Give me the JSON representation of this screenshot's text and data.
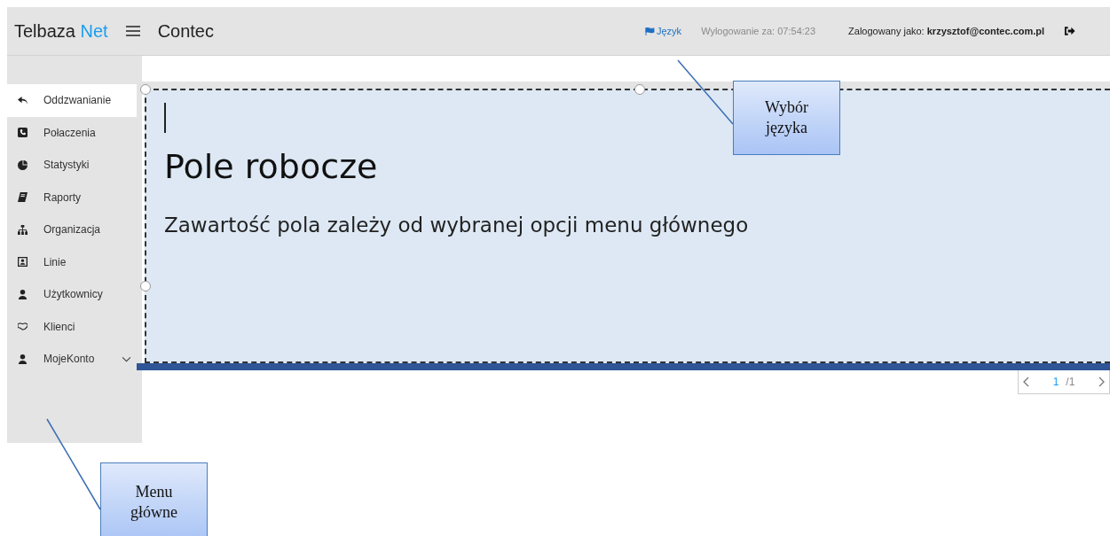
{
  "header": {
    "logo": {
      "text": "Telbaza",
      "accent": "Net"
    },
    "title": "Contec",
    "language_link": "Język",
    "logout_timer": "Wylogowanie za: 07:54:23",
    "logged_in": "Zalogowany jako: **krzysztof@contec.com.pl**"
  },
  "sidebar": {
    "items": [
      {
        "label": "Oddzwanianie",
        "selected": true,
        "expandable": false
      },
      {
        "label": "Połaczenia",
        "selected": false,
        "expandable": false
      },
      {
        "label": "Statystyki",
        "selected": false,
        "expandable": false
      },
      {
        "label": "Raporty",
        "selected": false,
        "expandable": false
      },
      {
        "label": "Organizacja",
        "selected": false,
        "expandable": false
      },
      {
        "label": "Linie",
        "selected": false,
        "expandable": false
      },
      {
        "label": "Użytkownicy",
        "selected": false,
        "expandable": false
      },
      {
        "label": "Klienci",
        "selected": false,
        "expandable": false
      },
      {
        "label": "MojeKonto",
        "selected": false,
        "expandable": true
      }
    ]
  },
  "workspace": {
    "heading": "Pole robocze",
    "text": "Zawartość pola zależy od wybranej opcji menu głównego"
  },
  "pager": {
    "current": "1",
    "total": "/1"
  },
  "callouts": [
    {
      "text": "Wybór języka"
    },
    {
      "text": "Menu główne"
    }
  ]
}
